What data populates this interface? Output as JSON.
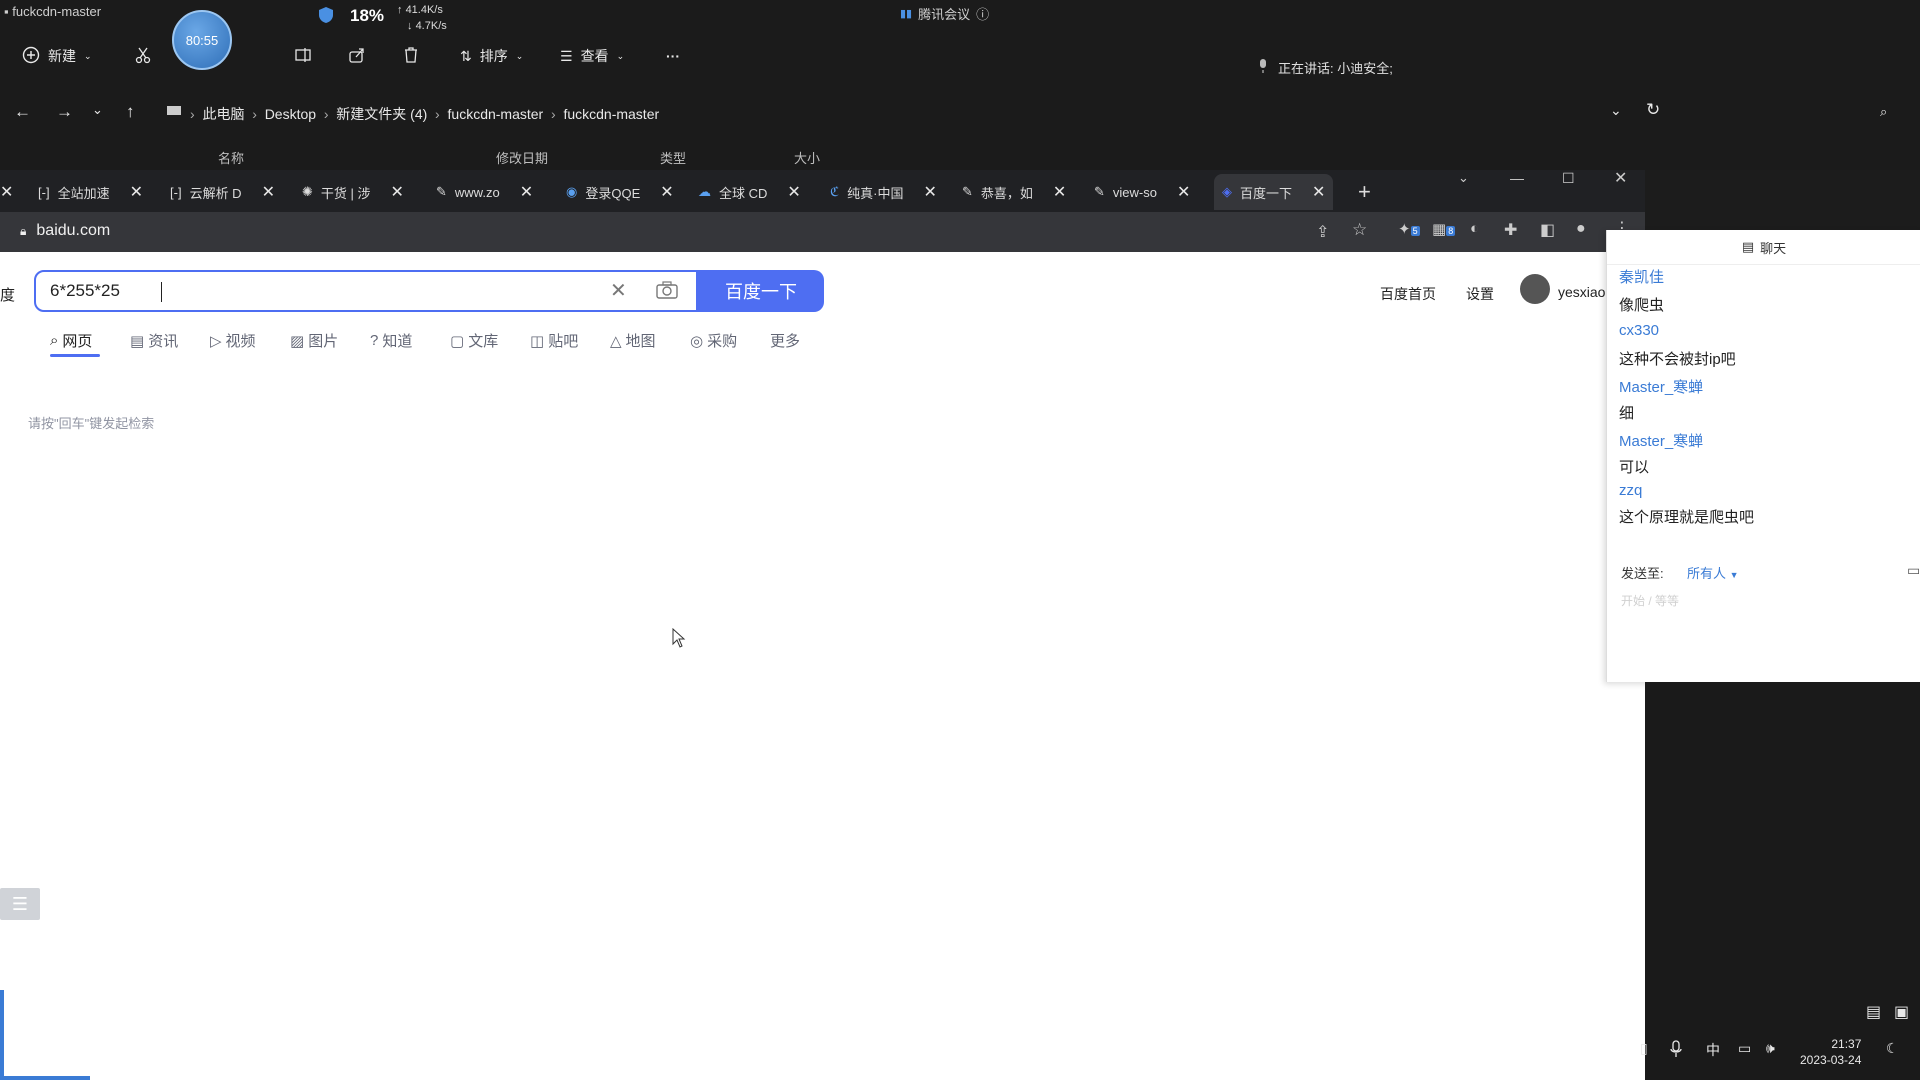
{
  "explorer": {
    "title": "fuckcdn-master",
    "timer": "80:55",
    "cpu_percent": "18%",
    "net_up": "41.4K/s",
    "net_down": "4.7K/s",
    "toolbar": {
      "new_label": "新建",
      "sort_label": "排序",
      "view_label": "查看",
      "more_label": "···"
    },
    "meeting_app": "腾讯会议",
    "speaking": "正在讲话: 小迪安全;",
    "breadcrumbs": [
      "此电脑",
      "Desktop",
      "新建文件夹 (4)",
      "fuckcdn-master",
      "fuckcdn-master"
    ],
    "columns": [
      "名称",
      "修改日期",
      "类型",
      "大小"
    ]
  },
  "browser": {
    "tabs": [
      {
        "label": "全站加速"
      },
      {
        "label": "云解析 D"
      },
      {
        "label": "干货 | 涉"
      },
      {
        "label": "www.zo"
      },
      {
        "label": "登录QQE"
      },
      {
        "label": "全球 CD"
      },
      {
        "label": "纯真·中国"
      },
      {
        "label": "恭喜，如"
      },
      {
        "label": "view-so"
      },
      {
        "label": "百度一下"
      }
    ],
    "new_tab": "+",
    "url": "baidu.com",
    "extension_badges": [
      "5",
      "8"
    ]
  },
  "baidu": {
    "query": "6*255*25",
    "search_button": "百度一下",
    "nav_tabs": [
      "网页",
      "资讯",
      "视频",
      "图片",
      "知道",
      "文库",
      "贴吧",
      "地图",
      "采购",
      "更多"
    ],
    "hint": "请按\"回车\"键发起检索",
    "home_link": "百度首页",
    "settings_link": "设置",
    "username": "yesxiao"
  },
  "chat": {
    "title": "聊天",
    "messages": [
      {
        "name": "秦凯佳",
        "text": "像爬虫"
      },
      {
        "name": "cx330",
        "text": "这种不会被封ip吧"
      },
      {
        "name": "Master_寒蝉",
        "text": "细"
      },
      {
        "name": "Master_寒蝉",
        "text": "可以"
      },
      {
        "name": "zzq",
        "text": "这个原理就是爬虫吧"
      }
    ],
    "send_to_label": "发送至:",
    "send_to_target": "所有人",
    "input_placeholder": "开始 / 等等"
  },
  "taskbar": {
    "ime": "中",
    "time": "21:37",
    "date": "2023-03-24"
  },
  "colors": {
    "baidu_blue": "#4e6ef2",
    "chat_name": "#3a7bd5",
    "explorer_bg": "#1b1b1b"
  }
}
